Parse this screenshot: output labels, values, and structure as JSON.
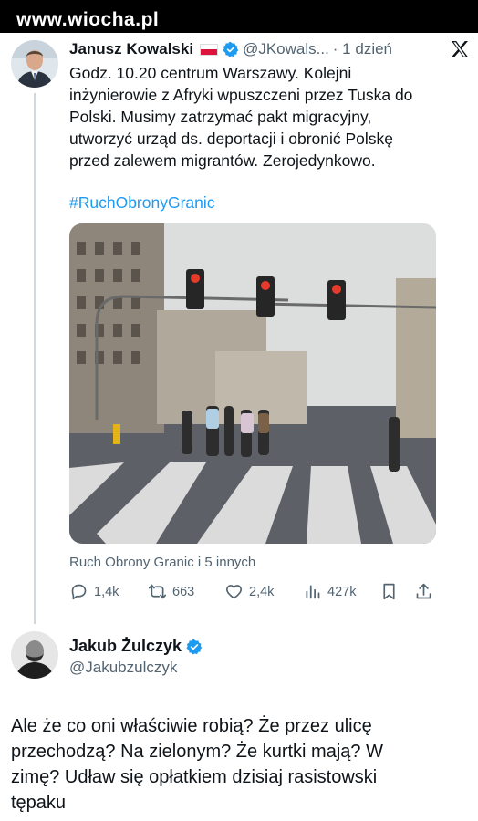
{
  "watermark": "www.wiocha.pl",
  "tweet1": {
    "author_name": "Janusz Kowalski",
    "handle": "@JKowals...",
    "time": "· 1 dzień",
    "text": "Godz. 10.20 centrum Warszawy. Kolejni\ninżynierowie z Afryki wpuszczeni przez Tuska do\nPolski. Musimy zatrzymać pakt migracyjny,\nutworzyć urząd ds. deportacji i obronić Polskę\nprzed zalewem migrantów. Zerojedynkowo.",
    "hashtag": "#RuchObronyGranic",
    "social_context": "Ruch Obrony Granic i 5 innych",
    "stats": {
      "replies": "1,4k",
      "retweets": "663",
      "likes": "2,4k",
      "views": "427k"
    },
    "icons": {
      "flag": "poland-flag-icon",
      "verified": "verified-badge-icon",
      "platform": "x-logo-icon"
    }
  },
  "tweet2": {
    "author_name": "Jakub Żulczyk",
    "handle": "@Jakubzulczyk",
    "text": "Ale że co oni właściwie robią? Że przez ulicę\nprzechodzą? Na zielonym? Że kurtki mają? W\nzimę? Udław się opłatkiem dzisiaj rasistowski\ntępaku"
  },
  "colors": {
    "accent": "#1d9bf0",
    "secondary_text": "#536471",
    "primary_text": "#0f1419",
    "thread_line": "#cfd9de"
  }
}
